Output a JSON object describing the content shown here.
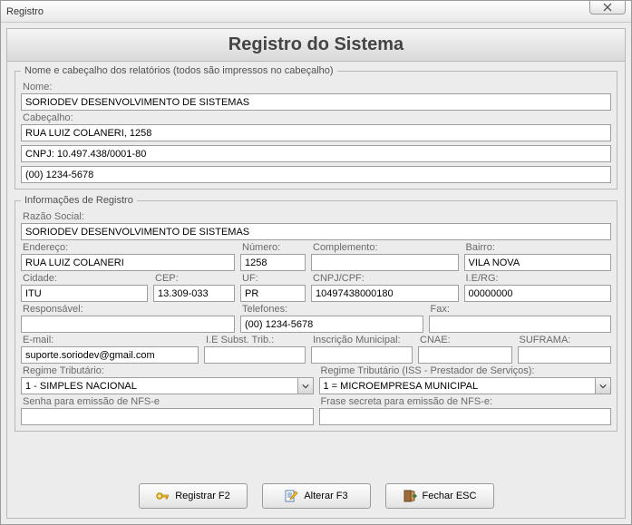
{
  "window": {
    "title": "Registro"
  },
  "header": {
    "title": "Registro do Sistema"
  },
  "groups": {
    "headerGroup": {
      "legend": "Nome e cabeçalho dos relatórios (todos são impressos no cabeçalho)",
      "nome_label": "Nome:",
      "nome": "SORIODEV DESENVOLVIMENTO DE SISTEMAS",
      "cabecalho_label": "Cabeçalho:",
      "linha1": "RUA LUIZ COLANERI, 1258",
      "linha2": "CNPJ: 10.497.438/0001-80",
      "linha3": "(00) 1234-5678"
    },
    "registro": {
      "legend": "Informações de Registro",
      "razao_label": "Razão Social:",
      "razao": "SORIODEV DESENVOLVIMENTO DE SISTEMAS",
      "endereco_label": "Endereço:",
      "endereco": "RUA LUIZ COLANERI",
      "numero_label": "Número:",
      "numero": "1258",
      "complemento_label": "Complemento:",
      "complemento": "",
      "bairro_label": "Bairro:",
      "bairro": "VILA NOVA",
      "cidade_label": "Cidade:",
      "cidade": "ITU",
      "cep_label": "CEP:",
      "cep": "13.309-033",
      "uf_label": "UF:",
      "uf": "PR",
      "cnpj_label": "CNPJ/CPF:",
      "cnpj": "10497438000180",
      "ie_label": "I.E/RG:",
      "ie": "00000000",
      "responsavel_label": "Responsável:",
      "responsavel": "",
      "telefones_label": "Telefones:",
      "telefones": "(00) 1234-5678",
      "fax_label": "Fax:",
      "fax": "",
      "email_label": "E-mail:",
      "email": "suporte.soriodev@gmail.com",
      "iesubst_label": "I.E Subst. Trib.:",
      "iesubst": "",
      "inscmun_label": "Inscrição Municipal:",
      "inscmun": "",
      "cnae_label": "CNAE:",
      "cnae": "",
      "suframa_label": "SUFRAMA:",
      "suframa": "",
      "regtrib_label": "Regime Tributário:",
      "regtrib": "1 - SIMPLES NACIONAL",
      "regtribiss_label": "Regime Tributário (ISS - Prestador de Serviços):",
      "regtribiss": "1 = MICROEMPRESA MUNICIPAL",
      "senha_label": "Senha para emissão de NFS-e",
      "senha": "",
      "frase_label": "Frase secreta para emissão de NFS-e:",
      "frase": ""
    }
  },
  "buttons": {
    "registrar": "Registrar F2",
    "alterar": "Alterar F3",
    "fechar": "Fechar ESC"
  }
}
